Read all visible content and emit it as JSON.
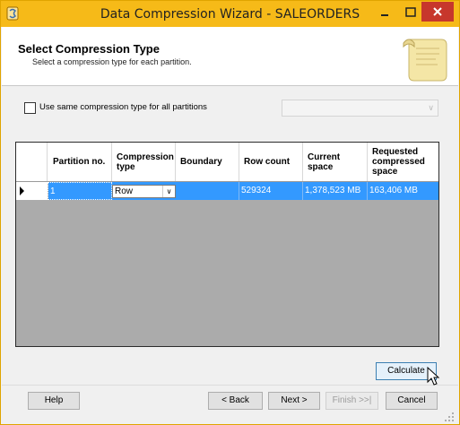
{
  "window": {
    "title": "Data Compression Wizard - SALEORDERS"
  },
  "header": {
    "title": "Select Compression Type",
    "subtitle": "Select a compression type for each partition."
  },
  "options": {
    "same_compression_label": "Use same compression type for all partitions",
    "same_compression_checked": false
  },
  "grid": {
    "columns": [
      "Partition no.",
      "Compression type",
      "Boundary",
      "Row count",
      "Current space",
      "Requested compressed space"
    ],
    "rows": [
      {
        "partition_no": "1",
        "compression_type": "Row",
        "boundary": "",
        "row_count": "529324",
        "current_space": "1,378,523 MB",
        "requested_space": "163,406 MB"
      }
    ]
  },
  "buttons": {
    "calculate": "Calculate",
    "help": "Help",
    "back": "< Back",
    "next": "Next >",
    "finish": "Finish >>|",
    "cancel": "Cancel"
  },
  "colors": {
    "titlebar": "#f6ba18",
    "close_button": "#c7372c",
    "selection": "#3399ff"
  }
}
